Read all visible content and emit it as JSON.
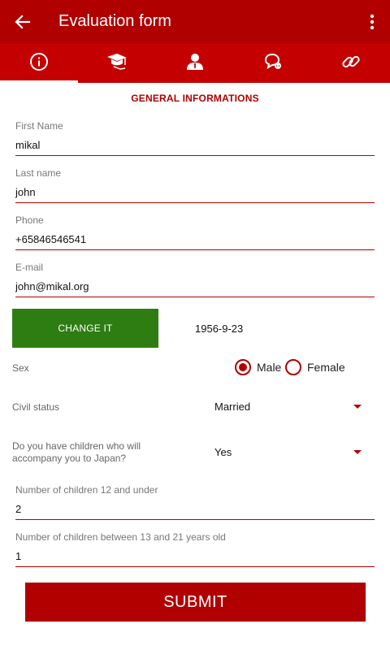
{
  "app_bar": {
    "title": "Evaluation form",
    "back_icon": "arrow-back-icon",
    "menu_icon": "more-vert-icon"
  },
  "tabs": [
    {
      "icon": "info-icon",
      "active": true
    },
    {
      "icon": "graduation-cap-icon",
      "active": false
    },
    {
      "icon": "person-icon",
      "active": false
    },
    {
      "icon": "chat-bubble-icon",
      "active": false
    },
    {
      "icon": "link-icon",
      "active": false
    }
  ],
  "section_title": "GENERAL INFORMATIONS",
  "fields": {
    "first_name": {
      "label": "First Name",
      "value": "mikal"
    },
    "last_name": {
      "label": "Last name",
      "value": "john"
    },
    "phone": {
      "label": "Phone",
      "value": "+65846546541"
    },
    "email": {
      "label": "E-mail",
      "value": "john@mikal.org"
    }
  },
  "birth_date": {
    "button_label": "CHANGE IT",
    "value": "1956-9-23"
  },
  "sex": {
    "label": "Sex",
    "options": [
      {
        "label": "Male",
        "selected": true
      },
      {
        "label": "Female",
        "selected": false
      }
    ]
  },
  "civil_status": {
    "label": "Civil status",
    "selected": "Married"
  },
  "children_accompany": {
    "label": "Do you have children who will accompany you to Japan?",
    "selected": "Yes"
  },
  "children_fields": {
    "under_12": {
      "label": "Number of children 12 and under",
      "value": "2"
    },
    "between_13_21": {
      "label": "Number of children between 13 and 21 years old",
      "value": "1"
    }
  },
  "submit_label": "SUBMIT",
  "colors": {
    "primary": "#b00000",
    "tab_bar": "#c40000",
    "change_button": "#2e7d12"
  }
}
